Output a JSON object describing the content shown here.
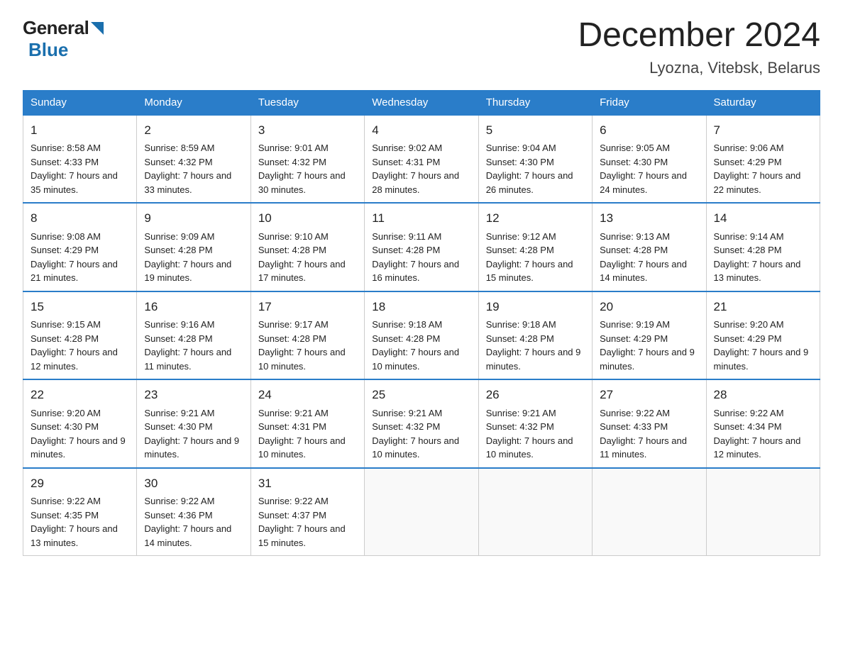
{
  "logo": {
    "general": "General",
    "blue": "Blue"
  },
  "title": {
    "month": "December 2024",
    "location": "Lyozna, Vitebsk, Belarus"
  },
  "headers": [
    "Sunday",
    "Monday",
    "Tuesday",
    "Wednesday",
    "Thursday",
    "Friday",
    "Saturday"
  ],
  "weeks": [
    [
      {
        "day": "1",
        "sunrise": "Sunrise: 8:58 AM",
        "sunset": "Sunset: 4:33 PM",
        "daylight": "Daylight: 7 hours and 35 minutes."
      },
      {
        "day": "2",
        "sunrise": "Sunrise: 8:59 AM",
        "sunset": "Sunset: 4:32 PM",
        "daylight": "Daylight: 7 hours and 33 minutes."
      },
      {
        "day": "3",
        "sunrise": "Sunrise: 9:01 AM",
        "sunset": "Sunset: 4:32 PM",
        "daylight": "Daylight: 7 hours and 30 minutes."
      },
      {
        "day": "4",
        "sunrise": "Sunrise: 9:02 AM",
        "sunset": "Sunset: 4:31 PM",
        "daylight": "Daylight: 7 hours and 28 minutes."
      },
      {
        "day": "5",
        "sunrise": "Sunrise: 9:04 AM",
        "sunset": "Sunset: 4:30 PM",
        "daylight": "Daylight: 7 hours and 26 minutes."
      },
      {
        "day": "6",
        "sunrise": "Sunrise: 9:05 AM",
        "sunset": "Sunset: 4:30 PM",
        "daylight": "Daylight: 7 hours and 24 minutes."
      },
      {
        "day": "7",
        "sunrise": "Sunrise: 9:06 AM",
        "sunset": "Sunset: 4:29 PM",
        "daylight": "Daylight: 7 hours and 22 minutes."
      }
    ],
    [
      {
        "day": "8",
        "sunrise": "Sunrise: 9:08 AM",
        "sunset": "Sunset: 4:29 PM",
        "daylight": "Daylight: 7 hours and 21 minutes."
      },
      {
        "day": "9",
        "sunrise": "Sunrise: 9:09 AM",
        "sunset": "Sunset: 4:28 PM",
        "daylight": "Daylight: 7 hours and 19 minutes."
      },
      {
        "day": "10",
        "sunrise": "Sunrise: 9:10 AM",
        "sunset": "Sunset: 4:28 PM",
        "daylight": "Daylight: 7 hours and 17 minutes."
      },
      {
        "day": "11",
        "sunrise": "Sunrise: 9:11 AM",
        "sunset": "Sunset: 4:28 PM",
        "daylight": "Daylight: 7 hours and 16 minutes."
      },
      {
        "day": "12",
        "sunrise": "Sunrise: 9:12 AM",
        "sunset": "Sunset: 4:28 PM",
        "daylight": "Daylight: 7 hours and 15 minutes."
      },
      {
        "day": "13",
        "sunrise": "Sunrise: 9:13 AM",
        "sunset": "Sunset: 4:28 PM",
        "daylight": "Daylight: 7 hours and 14 minutes."
      },
      {
        "day": "14",
        "sunrise": "Sunrise: 9:14 AM",
        "sunset": "Sunset: 4:28 PM",
        "daylight": "Daylight: 7 hours and 13 minutes."
      }
    ],
    [
      {
        "day": "15",
        "sunrise": "Sunrise: 9:15 AM",
        "sunset": "Sunset: 4:28 PM",
        "daylight": "Daylight: 7 hours and 12 minutes."
      },
      {
        "day": "16",
        "sunrise": "Sunrise: 9:16 AM",
        "sunset": "Sunset: 4:28 PM",
        "daylight": "Daylight: 7 hours and 11 minutes."
      },
      {
        "day": "17",
        "sunrise": "Sunrise: 9:17 AM",
        "sunset": "Sunset: 4:28 PM",
        "daylight": "Daylight: 7 hours and 10 minutes."
      },
      {
        "day": "18",
        "sunrise": "Sunrise: 9:18 AM",
        "sunset": "Sunset: 4:28 PM",
        "daylight": "Daylight: 7 hours and 10 minutes."
      },
      {
        "day": "19",
        "sunrise": "Sunrise: 9:18 AM",
        "sunset": "Sunset: 4:28 PM",
        "daylight": "Daylight: 7 hours and 9 minutes."
      },
      {
        "day": "20",
        "sunrise": "Sunrise: 9:19 AM",
        "sunset": "Sunset: 4:29 PM",
        "daylight": "Daylight: 7 hours and 9 minutes."
      },
      {
        "day": "21",
        "sunrise": "Sunrise: 9:20 AM",
        "sunset": "Sunset: 4:29 PM",
        "daylight": "Daylight: 7 hours and 9 minutes."
      }
    ],
    [
      {
        "day": "22",
        "sunrise": "Sunrise: 9:20 AM",
        "sunset": "Sunset: 4:30 PM",
        "daylight": "Daylight: 7 hours and 9 minutes."
      },
      {
        "day": "23",
        "sunrise": "Sunrise: 9:21 AM",
        "sunset": "Sunset: 4:30 PM",
        "daylight": "Daylight: 7 hours and 9 minutes."
      },
      {
        "day": "24",
        "sunrise": "Sunrise: 9:21 AM",
        "sunset": "Sunset: 4:31 PM",
        "daylight": "Daylight: 7 hours and 10 minutes."
      },
      {
        "day": "25",
        "sunrise": "Sunrise: 9:21 AM",
        "sunset": "Sunset: 4:32 PM",
        "daylight": "Daylight: 7 hours and 10 minutes."
      },
      {
        "day": "26",
        "sunrise": "Sunrise: 9:21 AM",
        "sunset": "Sunset: 4:32 PM",
        "daylight": "Daylight: 7 hours and 10 minutes."
      },
      {
        "day": "27",
        "sunrise": "Sunrise: 9:22 AM",
        "sunset": "Sunset: 4:33 PM",
        "daylight": "Daylight: 7 hours and 11 minutes."
      },
      {
        "day": "28",
        "sunrise": "Sunrise: 9:22 AM",
        "sunset": "Sunset: 4:34 PM",
        "daylight": "Daylight: 7 hours and 12 minutes."
      }
    ],
    [
      {
        "day": "29",
        "sunrise": "Sunrise: 9:22 AM",
        "sunset": "Sunset: 4:35 PM",
        "daylight": "Daylight: 7 hours and 13 minutes."
      },
      {
        "day": "30",
        "sunrise": "Sunrise: 9:22 AM",
        "sunset": "Sunset: 4:36 PM",
        "daylight": "Daylight: 7 hours and 14 minutes."
      },
      {
        "day": "31",
        "sunrise": "Sunrise: 9:22 AM",
        "sunset": "Sunset: 4:37 PM",
        "daylight": "Daylight: 7 hours and 15 minutes."
      },
      null,
      null,
      null,
      null
    ]
  ]
}
